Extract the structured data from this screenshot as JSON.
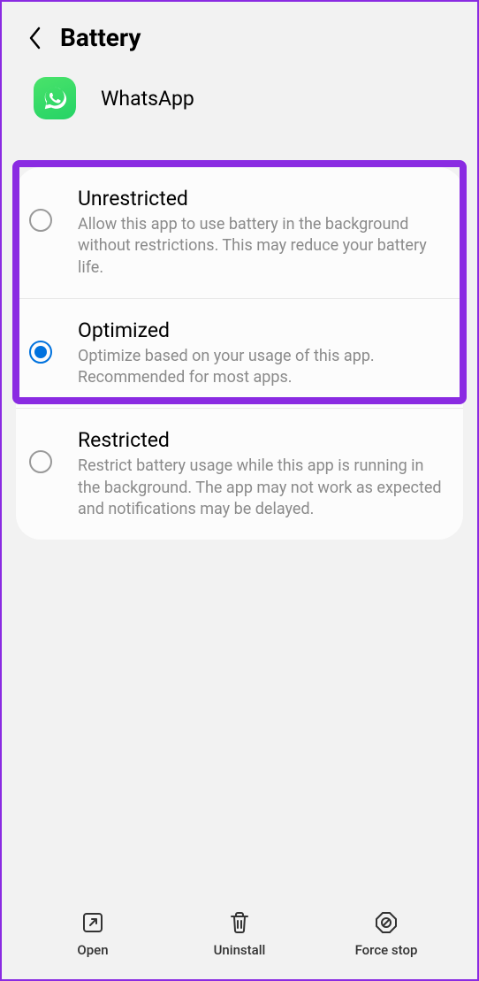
{
  "header": {
    "title": "Battery"
  },
  "app": {
    "name": "WhatsApp"
  },
  "options": [
    {
      "title": "Unrestricted",
      "desc": "Allow this app to use battery in the background without restrictions. This may reduce your battery life.",
      "selected": false
    },
    {
      "title": "Optimized",
      "desc": "Optimize based on your usage of this app. Recommended for most apps.",
      "selected": true
    },
    {
      "title": "Restricted",
      "desc": "Restrict battery usage while this app is running in the background. The app may not work as expected and notifications may be delayed.",
      "selected": false
    }
  ],
  "bottom": {
    "open": "Open",
    "uninstall": "Uninstall",
    "forcestop": "Force stop"
  }
}
